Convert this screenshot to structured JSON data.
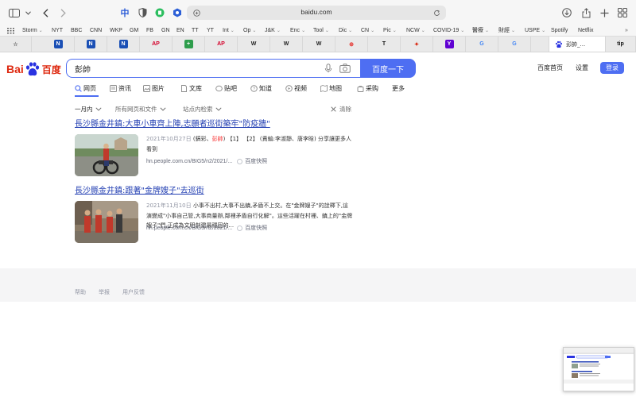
{
  "browser": {
    "url": "baidu.com",
    "favorites": [
      {
        "label": "Storm",
        "menu": true
      },
      {
        "label": "NYT",
        "menu": false
      },
      {
        "label": "BBC",
        "menu": false
      },
      {
        "label": "CNN",
        "menu": false
      },
      {
        "label": "WKP",
        "menu": false
      },
      {
        "label": "GM",
        "menu": false
      },
      {
        "label": "FB",
        "menu": false
      },
      {
        "label": "GN",
        "menu": false
      },
      {
        "label": "EN",
        "menu": false
      },
      {
        "label": "TT",
        "menu": false
      },
      {
        "label": "YT",
        "menu": false
      },
      {
        "label": "Int",
        "menu": true
      },
      {
        "label": "Op",
        "menu": true
      },
      {
        "label": "J&K",
        "menu": true
      },
      {
        "label": "Enc",
        "menu": true
      },
      {
        "label": "Tool",
        "menu": true
      },
      {
        "label": "Dic",
        "menu": true
      },
      {
        "label": "CN",
        "menu": true
      },
      {
        "label": "Pic",
        "menu": true
      },
      {
        "label": "NCW",
        "menu": true
      },
      {
        "label": "COVID-19",
        "menu": true
      },
      {
        "label": "醫療",
        "menu": true
      },
      {
        "label": "財經",
        "menu": true
      },
      {
        "label": "USPE",
        "menu": true
      },
      {
        "label": "Spotify",
        "menu": false
      },
      {
        "label": "Netflix",
        "menu": false
      }
    ],
    "tabs": [
      {
        "icon": "bookmark-star-icon",
        "text": "☆"
      },
      {
        "icon": "n-icon",
        "text": "N"
      },
      {
        "icon": "n-icon",
        "text": "N"
      },
      {
        "icon": "n-icon",
        "text": "N"
      },
      {
        "icon": "ap-icon",
        "text": "AP"
      },
      {
        "icon": "plus-green-icon",
        "text": "+"
      },
      {
        "icon": "ap-icon",
        "text": "AP"
      },
      {
        "icon": "wikipedia-icon",
        "text": "W"
      },
      {
        "icon": "wikipedia-icon",
        "text": "W"
      },
      {
        "icon": "wikipedia-icon",
        "text": "W"
      },
      {
        "icon": "red-circle-icon",
        "text": "⊕"
      },
      {
        "icon": "nyt-icon",
        "text": "T"
      },
      {
        "icon": "flag-icon",
        "text": "✦"
      },
      {
        "icon": "yahoo-icon",
        "text": "Y"
      },
      {
        "icon": "google-icon",
        "text": "G"
      },
      {
        "icon": "google-icon",
        "text": "G"
      }
    ],
    "active_tab_title": "彭帥_...",
    "last_tab_text": "tip"
  },
  "baidu": {
    "logo_bai": "Bai",
    "logo_du": "du",
    "logo_cn": "百度",
    "query": "彭帥",
    "search_button": "百度一下",
    "header_links": {
      "home": "百度首页",
      "settings": "设置",
      "login": "登录"
    },
    "tabs": [
      {
        "label": "网页",
        "icon": "search-icon"
      },
      {
        "label": "资讯",
        "icon": "news-icon"
      },
      {
        "label": "图片",
        "icon": "image-icon"
      },
      {
        "label": "文库",
        "icon": "doc-icon"
      },
      {
        "label": "贴吧",
        "icon": "tieba-icon"
      },
      {
        "label": "知道",
        "icon": "question-icon"
      },
      {
        "label": "视频",
        "icon": "video-icon"
      },
      {
        "label": "地图",
        "icon": "map-icon"
      },
      {
        "label": "采购",
        "icon": "bag-icon"
      },
      {
        "label": "更多",
        "icon": ""
      }
    ],
    "filters": {
      "time": "一月内",
      "type": "所有网页和文件",
      "site": "站点内检索",
      "clear": "清除"
    },
    "results": [
      {
        "title": "長沙縣金井鎮:大車小車齊上陣,志願者巡街築牢\"防疫牆\"",
        "date": "2021年10月27日",
        "snippet_pre": " (鎬彩、",
        "snippet_hl": "彭帥",
        "snippet_post": ") 【1】 【2】 (責編:李淑靜、唐李晗) 分享讓更多人看到",
        "source": "hn.people.com.cn/BIG5/n2/2021/...",
        "snapshot": "百度快照"
      },
      {
        "title": "長沙縣金井鎮:跟著\"金牌嫂子\"去巡街",
        "date": "2021年11月10日",
        "snippet_pre": " 小事不出村,大事不出鎮,矛盾不上交。在\"金牌嫂子\"的詮釋下,這演變成\"小事自己管,大事商量辦,鄰裡矛盾自行化解\"。這些活躍在村裡、鎮上的\"金牌嫂子\"們,正成為文明創建最穩固的...",
        "snippet_hl": "",
        "snippet_post": "",
        "source": "hn.people.com.cn/BIG5/n2/2021/...",
        "snapshot": "百度快照"
      }
    ],
    "footer": [
      "帮助",
      "举报",
      "用户反馈"
    ]
  }
}
